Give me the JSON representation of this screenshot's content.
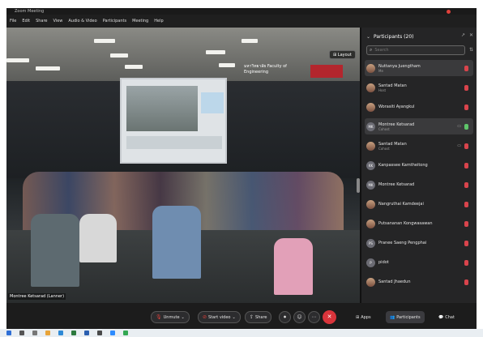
{
  "window": {
    "title": "Zoom Meeting"
  },
  "menu": [
    "File",
    "Edit",
    "Share",
    "View",
    "Audio & Video",
    "Participants",
    "Meeting",
    "Help"
  ],
  "video": {
    "layout_label": "Layout",
    "speaker_name": "Montree Ketsarad (Lanner)",
    "banner_text": "มหาวิทยาลัย Faculty of Engineering"
  },
  "participants_panel": {
    "title": "Participants (20)",
    "search_placeholder": "Search",
    "items": [
      {
        "name": "Nuttanya Juengtham",
        "role": "Me",
        "mic": "muted",
        "avatar": "photo"
      },
      {
        "name": "Santad Matan",
        "role": "Host",
        "mic": "muted",
        "avatar": "photo"
      },
      {
        "name": "Worasiti Ayangkul",
        "role": "",
        "mic": "muted",
        "avatar": "photo"
      },
      {
        "name": "Montree Ketsarad",
        "role": "Cohost",
        "mic": "on",
        "avatar": "initials",
        "initials": "MK"
      },
      {
        "name": "Santad Matan",
        "role": "Cohost",
        "mic": "muted",
        "avatar": "photo"
      },
      {
        "name": "Kanpassee Kamtheitong",
        "role": "",
        "mic": "muted",
        "avatar": "initials",
        "initials": "KK"
      },
      {
        "name": "Montree Ketsarad",
        "role": "",
        "mic": "muted",
        "avatar": "initials",
        "initials": "MK"
      },
      {
        "name": "Nangruthai Kamdeejai",
        "role": "",
        "mic": "muted",
        "avatar": "photo"
      },
      {
        "name": "Putsananan Kongwasawan",
        "role": "",
        "mic": "muted",
        "avatar": "photo"
      },
      {
        "name": "Pranee Saeng Pengphai",
        "role": "",
        "mic": "muted",
        "avatar": "initials",
        "initials": "PS"
      },
      {
        "name": "pidot",
        "role": "",
        "mic": "muted",
        "avatar": "initials",
        "initials": "P"
      },
      {
        "name": "Santad Jhaedun",
        "role": "",
        "mic": "muted",
        "avatar": "photo"
      }
    ]
  },
  "controls": {
    "unmute": "Unmute",
    "start_video": "Start video",
    "share": "Share",
    "apps": "Apps",
    "participants": "Participants",
    "chat": "Chat"
  },
  "colors": {
    "panel_bg": "#252526",
    "accent_red": "#d9343b",
    "mic_on": "#5ec56a"
  }
}
